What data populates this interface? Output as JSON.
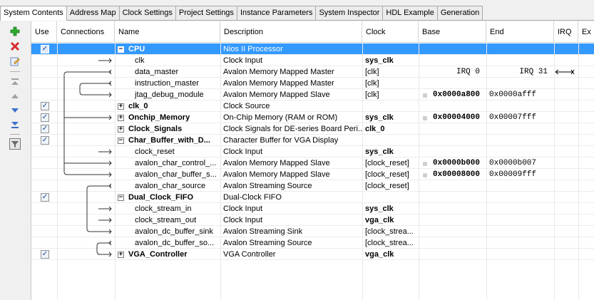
{
  "tabs": [
    "System Contents",
    "Address Map",
    "Clock Settings",
    "Project Settings",
    "Instance Parameters",
    "System Inspector",
    "HDL Example",
    "Generation"
  ],
  "active_tab": "System Contents",
  "columns": {
    "use": "Use",
    "connections": "Connections",
    "name": "Name",
    "description": "Description",
    "clock": "Clock",
    "base": "Base",
    "end": "End",
    "irq": "IRQ",
    "ex": "Ex"
  },
  "toolbar_icons": [
    "add-icon",
    "remove-icon",
    "edit-icon",
    "move-top-icon",
    "move-up-icon",
    "move-down-icon",
    "move-bottom-icon",
    "filter-icon"
  ],
  "rows": [
    {
      "use": true,
      "expander": "−",
      "name": "CPU",
      "bold": true,
      "desc": "Nios II Processor",
      "clock": "",
      "base": "",
      "end": "",
      "selected": true
    },
    {
      "use": null,
      "expander": "",
      "name": "clk",
      "bold": false,
      "desc": "Clock Input",
      "clock": "sys_clk",
      "clock_bold": true,
      "base": "",
      "end": ""
    },
    {
      "use": null,
      "expander": "",
      "name": "data_master",
      "bold": false,
      "desc": "Avalon Memory Mapped Master",
      "clock": "[clk]",
      "base": "IRQ 0",
      "end": "IRQ 31"
    },
    {
      "use": null,
      "expander": "",
      "name": "instruction_master",
      "bold": false,
      "desc": "Avalon Memory Mapped Master",
      "clock": "[clk]",
      "base": "",
      "end": ""
    },
    {
      "use": null,
      "expander": "",
      "name": "jtag_debug_module",
      "bold": false,
      "desc": "Avalon Memory Mapped Slave",
      "clock": "[clk]",
      "base": "0x0000a800",
      "end": "0x0000afff",
      "lock": true
    },
    {
      "use": true,
      "expander": "+",
      "name": "clk_0",
      "bold": true,
      "desc": "Clock Source",
      "clock": "",
      "base": "",
      "end": ""
    },
    {
      "use": true,
      "expander": "+",
      "name": "Onchip_Memory",
      "bold": true,
      "desc": "On-Chip Memory (RAM or ROM)",
      "clock": "sys_clk",
      "clock_bold": true,
      "base": "0x00004000",
      "end": "0x00007fff",
      "lock": true
    },
    {
      "use": true,
      "expander": "+",
      "name": "Clock_Signals",
      "bold": true,
      "desc": "Clock Signals for DE-series Board Peri...",
      "clock": "clk_0",
      "clock_bold": true,
      "base": "",
      "end": ""
    },
    {
      "use": true,
      "expander": "−",
      "name": "Char_Buffer_with_D...",
      "bold": true,
      "desc": "Character Buffer for VGA Display",
      "clock": "",
      "base": "",
      "end": ""
    },
    {
      "use": null,
      "expander": "",
      "name": "clock_reset",
      "bold": false,
      "desc": "Clock Input",
      "clock": "sys_clk",
      "clock_bold": true,
      "base": "",
      "end": ""
    },
    {
      "use": null,
      "expander": "",
      "name": "avalon_char_control_...",
      "bold": false,
      "desc": "Avalon Memory Mapped Slave",
      "clock": "[clock_reset]",
      "base": "0x0000b000",
      "end": "0x0000b007",
      "lock": true
    },
    {
      "use": null,
      "expander": "",
      "name": "avalon_char_buffer_s...",
      "bold": false,
      "desc": "Avalon Memory Mapped Slave",
      "clock": "[clock_reset]",
      "base": "0x00008000",
      "end": "0x00009fff",
      "lock": true
    },
    {
      "use": null,
      "expander": "",
      "name": "avalon_char_source",
      "bold": false,
      "desc": "Avalon Streaming Source",
      "clock": "[clock_reset]",
      "base": "",
      "end": ""
    },
    {
      "use": true,
      "expander": "−",
      "name": "Dual_Clock_FIFO",
      "bold": true,
      "desc": "Dual-Clock FIFO",
      "clock": "",
      "base": "",
      "end": ""
    },
    {
      "use": null,
      "expander": "",
      "name": "clock_stream_in",
      "bold": false,
      "desc": "Clock Input",
      "clock": "sys_clk",
      "clock_bold": true,
      "base": "",
      "end": ""
    },
    {
      "use": null,
      "expander": "",
      "name": "clock_stream_out",
      "bold": false,
      "desc": "Clock Input",
      "clock": "vga_clk",
      "clock_bold": true,
      "base": "",
      "end": ""
    },
    {
      "use": null,
      "expander": "",
      "name": "avalon_dc_buffer_sink",
      "bold": false,
      "desc": "Avalon Streaming Sink",
      "clock": "[clock_strea...",
      "base": "",
      "end": ""
    },
    {
      "use": null,
      "expander": "",
      "name": "avalon_dc_buffer_so...",
      "bold": false,
      "desc": "Avalon Streaming Source",
      "clock": "[clock_strea...",
      "base": "",
      "end": ""
    },
    {
      "use": true,
      "expander": "+",
      "name": "VGA_Controller",
      "bold": true,
      "desc": "VGA Controller",
      "clock": "vga_clk",
      "clock_bold": true,
      "base": "",
      "end": ""
    }
  ],
  "colors": {
    "selection": "#3399ff",
    "add": "#2eaa2e",
    "remove": "#d62b2b",
    "arrow": "#3b6fc7"
  }
}
